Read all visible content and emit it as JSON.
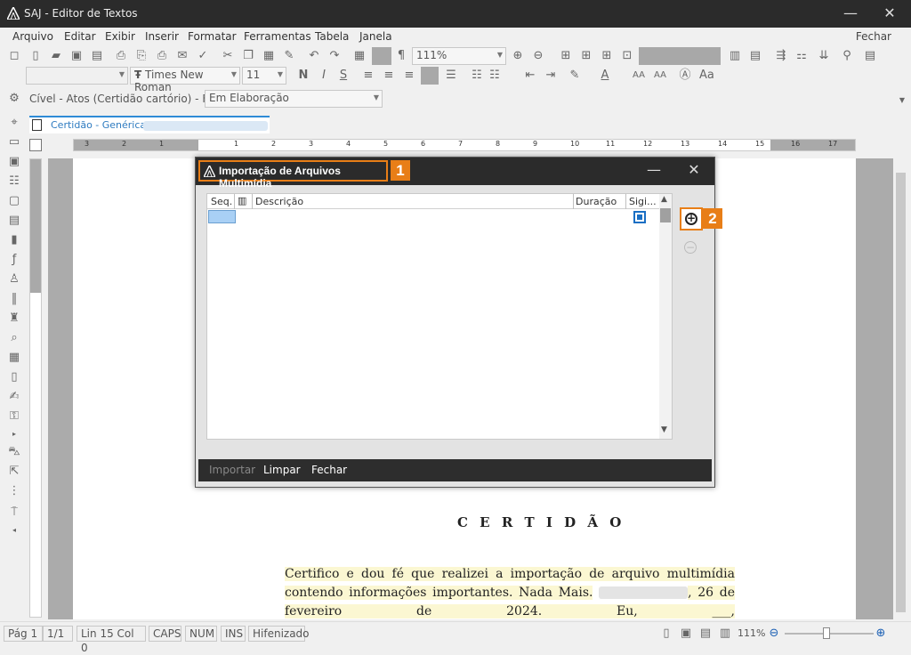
{
  "app": {
    "title": "SAJ - Editor de Textos"
  },
  "window_controls": {
    "minimize": "—",
    "close": "✕"
  },
  "menu": {
    "items": [
      "Arquivo",
      "Editar",
      "Exibir",
      "Inserir",
      "Formatar",
      "Ferramentas",
      "Tabela",
      "Janela"
    ],
    "fechar": "Fechar"
  },
  "toolbar": {
    "zoom_value": "111%",
    "font_name": "Times New Roman",
    "font_size": "11",
    "font_prefix": "Ŧ"
  },
  "fila_bar": {
    "label": "Cível - Atos (Certidão cartório) - Fila:",
    "status_value": "Em Elaboração"
  },
  "document_tab": {
    "label": "Certidão - Genérica"
  },
  "ruler": {
    "numbers": [
      "3",
      "2",
      "1",
      "1",
      "2",
      "3",
      "4",
      "5",
      "6",
      "7",
      "8",
      "9",
      "10",
      "11",
      "12",
      "13",
      "14",
      "15",
      "16",
      "17"
    ]
  },
  "document": {
    "heading": "C E R T I D Ã O",
    "body_part1": "Certifico e dou fé que realizei a importação de arquivo multimídia contendo informações importantes. Nada Mais.",
    "body_part2": ", 26 de fevereiro de 2024. Eu, ___, "
  },
  "dialog": {
    "title": "Importação de Arquivos Multimídia",
    "badge1": "1",
    "badge2": "2",
    "columns": {
      "seq": "Seq.",
      "descricao": "Descrição",
      "duracao": "Duração",
      "sigilo": "Sigi..."
    },
    "buttons": {
      "importar": "Importar",
      "limpar": "Limpar",
      "fechar": "Fechar"
    },
    "add_symbol": "+",
    "remove_symbol": "−"
  },
  "statusbar": {
    "page": "Pág 1",
    "page_count": "1/1",
    "position": "Lin 15  Col 0",
    "caps": "CAPS",
    "num": "NUM",
    "ins": "INS",
    "hyphen": "Hifenizado",
    "zoom": "111%"
  }
}
